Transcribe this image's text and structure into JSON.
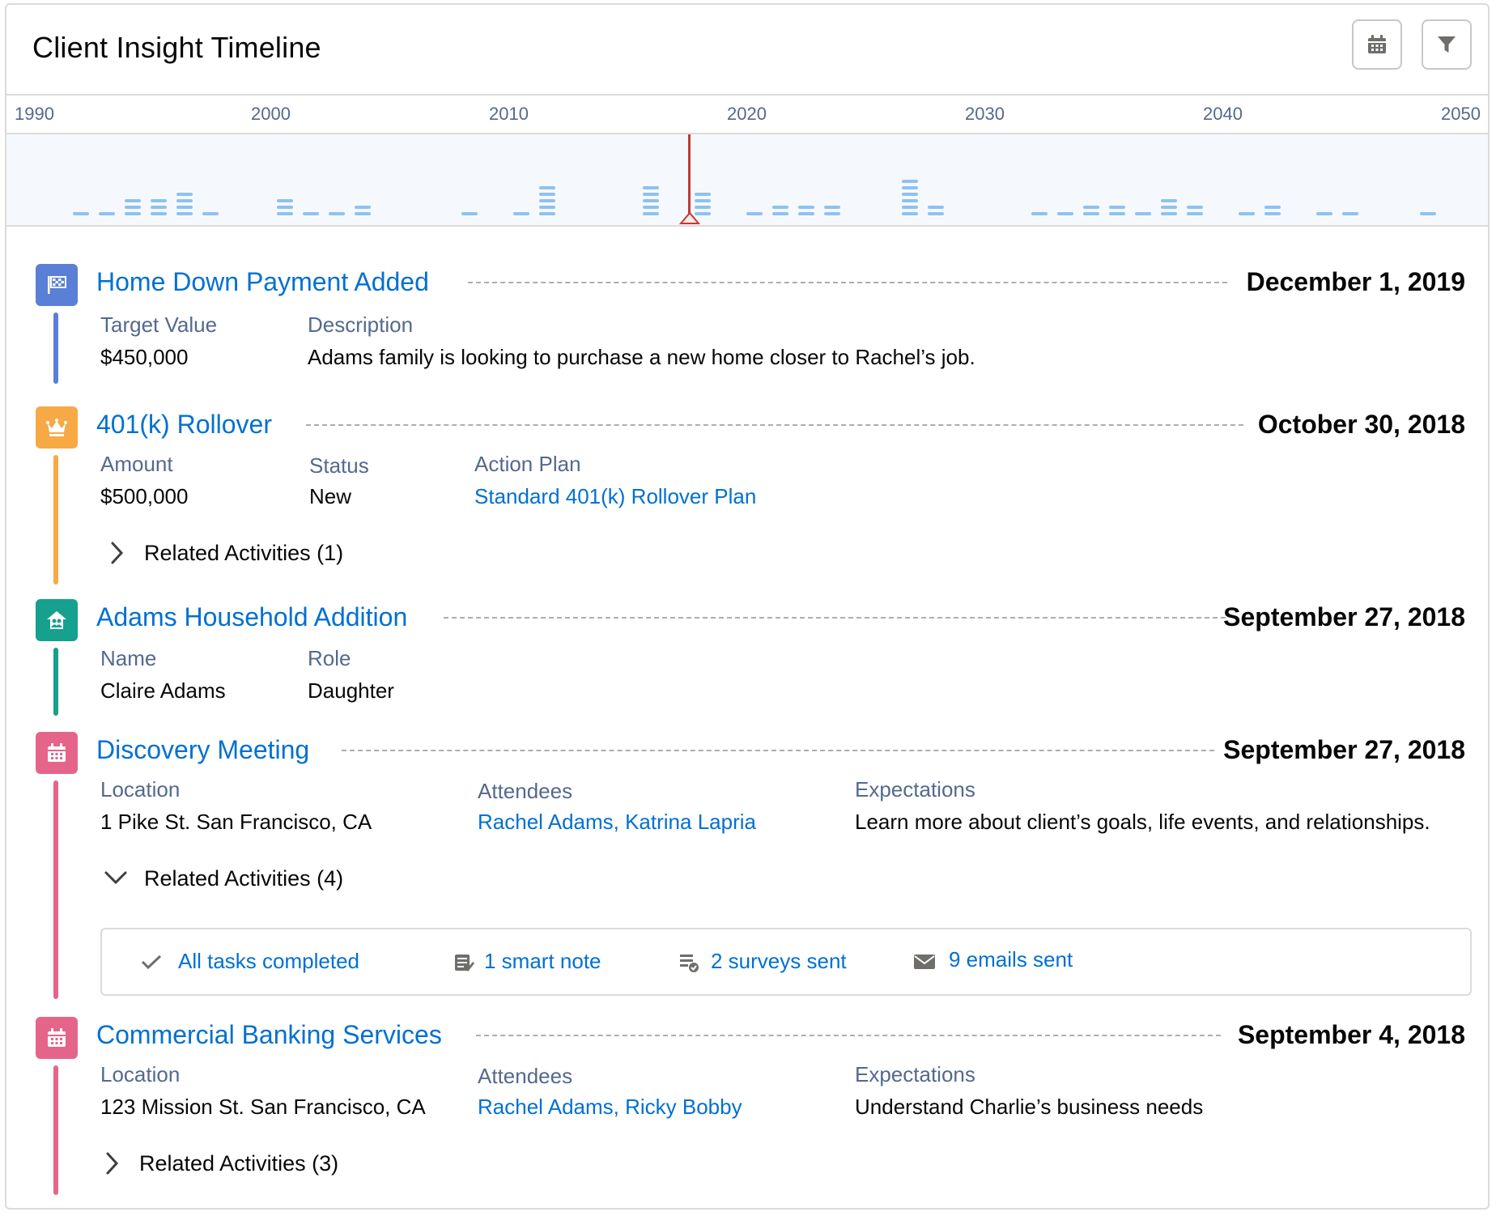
{
  "header": {
    "title": "Client Insight Timeline"
  },
  "axis": {
    "ticks": [
      "1990",
      "2000",
      "2010",
      "2020",
      "2030",
      "2040",
      "2050"
    ]
  },
  "colors": {
    "accent": "#0070d2",
    "marker": "#c23934",
    "flag": "#5a7fd6",
    "crown": "#f7a945",
    "household": "#16a08e",
    "event": "#e5658a"
  },
  "items": [
    {
      "title": "Home Down Payment Added",
      "date": "December 1, 2019",
      "icon": "flag-icon",
      "fields": [
        {
          "label": "Target Value",
          "value": "$450,000"
        },
        {
          "label": "Description",
          "value": "Adams family is looking to purchase a new home closer to Rachel’s job."
        }
      ]
    },
    {
      "title": "401(k) Rollover",
      "date": "October 30, 2018",
      "icon": "crown-icon",
      "fields": [
        {
          "label": "Amount",
          "value": "$500,000"
        },
        {
          "label": "Status",
          "value": "New"
        },
        {
          "label": "Action Plan",
          "value": "Standard 401(k) Rollover Plan"
        }
      ],
      "related": "Related Activities (1)"
    },
    {
      "title": "Adams Household Addition",
      "date": "September 27, 2018",
      "icon": "household-icon",
      "fields": [
        {
          "label": "Name",
          "value": "Claire Adams"
        },
        {
          "label": "Role",
          "value": "Daughter"
        }
      ]
    },
    {
      "title": "Discovery Meeting",
      "date": "September 27, 2018",
      "icon": "calendar-icon",
      "fields": [
        {
          "label": "Location",
          "value": "1 Pike St. San Francisco, CA"
        },
        {
          "label": "Attendees",
          "value": "Rachel Adams, Katrina Lapria"
        },
        {
          "label": "Expectations",
          "value": "Learn more about client’s goals, life events, and relationships."
        }
      ],
      "related": "Related Activities (4)",
      "activities": [
        "All tasks completed",
        "1 smart note",
        "2 surveys sent",
        "9 emails sent"
      ]
    },
    {
      "title": "Commercial Banking Services",
      "date": "September 4, 2018",
      "icon": "calendar-icon",
      "fields": [
        {
          "label": "Location",
          "value": "123 Mission St. San Francisco, CA"
        },
        {
          "label": "Attendees",
          "value": "Rachel Adams, Ricky Bobby"
        },
        {
          "label": "Expectations",
          "value": "Understand Charlie’s business needs"
        }
      ],
      "related": "Related Activities (3)"
    }
  ]
}
